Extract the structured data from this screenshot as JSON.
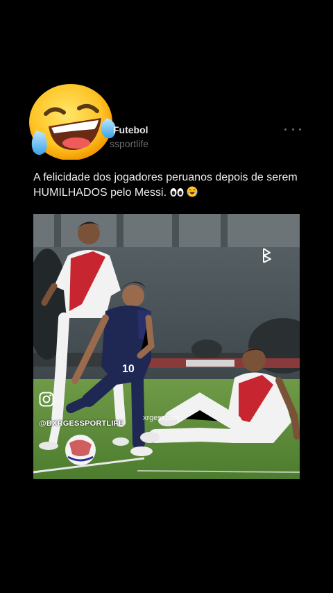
{
  "post": {
    "author_name": "Futebol",
    "author_handle": "ssportlife",
    "caption_text": "A felicidade dos jogadores peruanos depois de serem HUMILHADOS pelo Messi.",
    "caption_emojis": [
      "eyes-icon",
      "laughing-icon"
    ]
  },
  "media": {
    "description_icon": "photo",
    "watermark_handle": "@BXRGESSPORTLIFE",
    "watermark_center": "xrgessport",
    "player_number": "10"
  },
  "icons": {
    "avatar": "rolling-laughing-emoji",
    "more": "more-dots-icon",
    "instagram": "instagram-icon",
    "brand": "brand-b-icon"
  },
  "colors": {
    "background": "#000000",
    "name_text": "#e6e6e6",
    "handle_text": "#6d6d6d",
    "pitch_green": "#5f8f3e",
    "peru_red": "#c7252f",
    "argentina_navy": "#1f2753"
  }
}
